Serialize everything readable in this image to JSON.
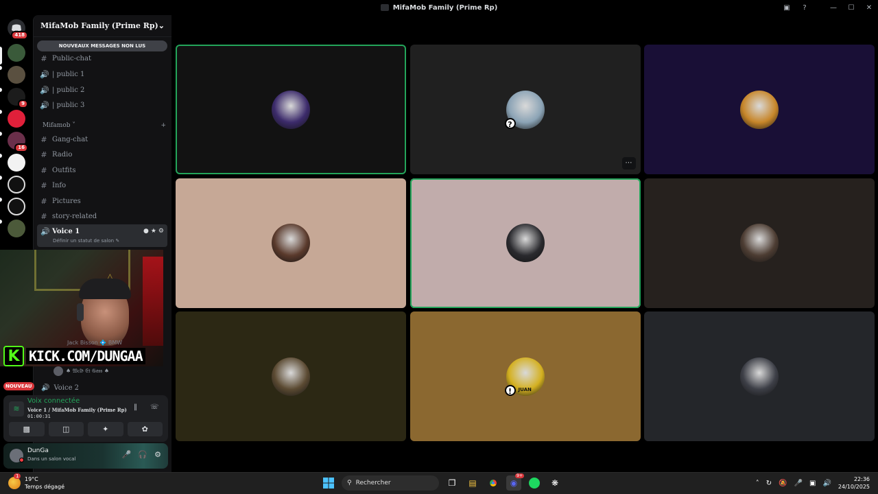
{
  "window": {
    "title": "MifaMob Family (Prime Rp)",
    "controls": [
      "—",
      "☐",
      "✕"
    ]
  },
  "rail": {
    "discord_badge": "418",
    "badges": [
      "9",
      "16"
    ],
    "nouveau": "NOUVEAU"
  },
  "sidebar": {
    "guild_name": "MifaMob Family (Prime Rp)",
    "unread_banner": "NOUVEAUX MESSAGES NON LUS",
    "top_channels": [
      {
        "icon": "#",
        "label": "Public-chat"
      },
      {
        "icon": "🔊",
        "label": "| public 1"
      },
      {
        "icon": "🔊",
        "label": "| public 2"
      },
      {
        "icon": "🔊",
        "label": "| public 3"
      }
    ],
    "category": {
      "label": "Mifamob ˅",
      "add": "+"
    },
    "channels": [
      {
        "icon": "#",
        "label": "Gang-chat"
      },
      {
        "icon": "#",
        "label": "Radio"
      },
      {
        "icon": "#",
        "label": "Outfits"
      },
      {
        "icon": "#",
        "label": "Info"
      },
      {
        "icon": "#",
        "label": "Pictures"
      },
      {
        "icon": "#",
        "label": "story-related"
      }
    ],
    "voice1": {
      "label": "Voice 1",
      "status": "Définir un statut de salon ✎"
    },
    "member_partial": "Jack Bisson 💠 BMW",
    "member": "♠ 𝔚𝔢𝔩𝔡 𝔈𝔱 𝔊𝔞𝔰𝔰 ♠",
    "voice2": {
      "label": "Voice 2"
    }
  },
  "kick_overlay": {
    "logo": "K",
    "text": "KICK.COM/DUNGAA"
  },
  "voice_panel": {
    "connected": "Voix connectée",
    "channel": "Voice 1 / MifaMob Family (Prime Rp)",
    "duration": "01:00:31"
  },
  "user_panel": {
    "name": "DunGa",
    "status": "Dans un salon vocal"
  },
  "tiles": [
    {
      "bg": "#121212",
      "avatar": "#3c2b6b",
      "speaking": true
    },
    {
      "bg": "#202020",
      "avatar": "#8ba3b5",
      "speaking": false,
      "badge": "?",
      "more": "⋯"
    },
    {
      "bg": "#190f36",
      "avatar": "#c7862a",
      "speaking": false
    },
    {
      "bg": "#c6a896",
      "avatar": "#5a3a2c",
      "speaking": false
    },
    {
      "bg": "#c1acab",
      "avatar": "#2a2a2e",
      "speaking": true
    },
    {
      "bg": "#26211e",
      "avatar": "#4d3d33",
      "speaking": false
    },
    {
      "bg": "#2c2814",
      "avatar": "#5b4a32",
      "speaking": false
    },
    {
      "bg": "#8b6830",
      "avatar": "#d4b020",
      "speaking": false,
      "badge": "!",
      "label": "JUAN"
    },
    {
      "bg": "#24262a",
      "avatar": "#3d3f47",
      "speaking": false
    }
  ],
  "taskbar": {
    "weather_temp": "19°C",
    "weather_desc": "Temps dégagé",
    "weather_badge": "1",
    "search": "Rechercher",
    "discord_badge": "9+",
    "time": "22:36",
    "date": "24/10/2025"
  },
  "colors": {
    "speaking": "#23a55a",
    "accent": "#5865f2",
    "danger": "#da373c"
  }
}
